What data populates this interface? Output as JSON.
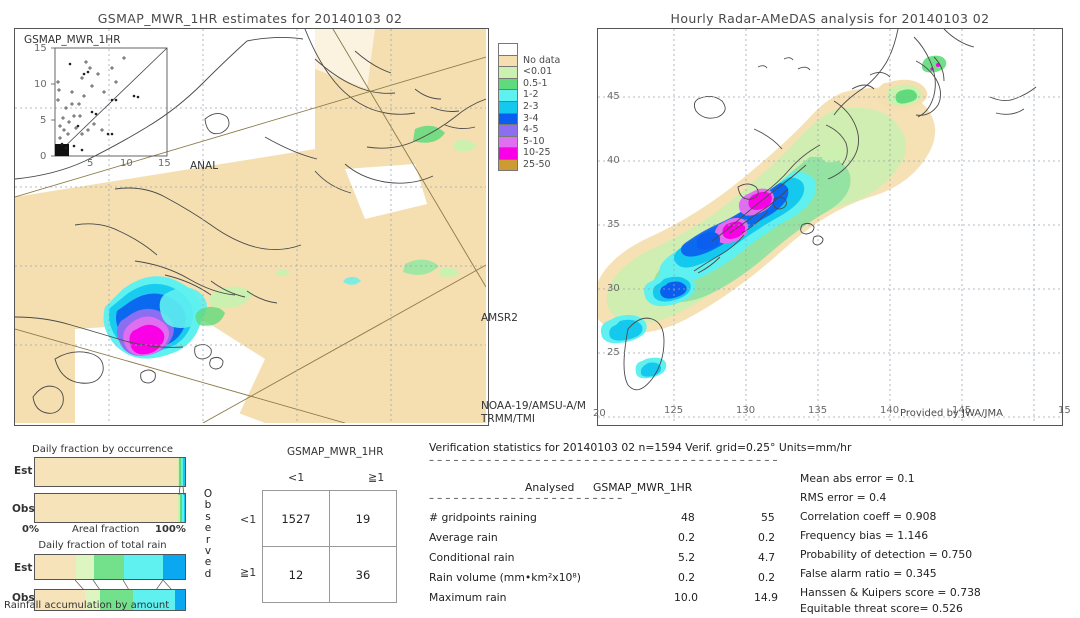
{
  "left_panel": {
    "title": "GSMAP_MWR_1HR estimates for 20140103 02",
    "inset": {
      "label": "GSMAP_MWR_1HR",
      "x_axis_label": "ANAL",
      "y_ticks": [
        "15",
        "10",
        "5",
        "0"
      ],
      "x_ticks": [
        "0",
        "5",
        "10",
        "15"
      ]
    },
    "annotations": [
      "AMSR2",
      "NOAA-19/AMSU-A/M",
      "TRMM/TMI"
    ]
  },
  "right_panel": {
    "title": "Hourly Radar-AMeDAS analysis for 20140103 02",
    "credit": "Provided by JWA/JMA",
    "lat_ticks": [
      "45",
      "40",
      "35",
      "30",
      "25",
      "20"
    ],
    "lon_ticks": [
      "125",
      "130",
      "135",
      "140",
      "145",
      "15"
    ]
  },
  "colorbar": {
    "entries": [
      {
        "label": "",
        "color": "#ffffff"
      },
      {
        "label": "No data",
        "color": "#f5dfb0"
      },
      {
        "label": "<0.01",
        "color": "#ccf0b0"
      },
      {
        "label": "0.5-1",
        "color": "#5fdb7b"
      },
      {
        "label": "1-2",
        "color": "#5ff0f0"
      },
      {
        "label": "2-3",
        "color": "#14c8ee"
      },
      {
        "label": "3-4",
        "color": "#0a5ef0"
      },
      {
        "label": "4-5",
        "color": "#8c6ef0"
      },
      {
        "label": "5-10",
        "color": "#e06ef0"
      },
      {
        "label": "10-25",
        "color": "#fa00e6"
      },
      {
        "label": "25-50",
        "color": "#cd9b32"
      }
    ]
  },
  "occurrence_chart": {
    "title": "Daily fraction by occurrence",
    "x_label": "Areal fraction",
    "x_min": "0%",
    "x_max": "100%",
    "rows": [
      {
        "label": "Est",
        "segments": [
          {
            "color": "#f7e3ba",
            "pct": 95.0
          },
          {
            "color": "#ccf0b0",
            "pct": 1.2
          },
          {
            "color": "#5fdb7b",
            "pct": 1.0
          },
          {
            "color": "#5ff0f0",
            "pct": 1.6
          },
          {
            "color": "#14c8ee",
            "pct": 1.2
          }
        ]
      },
      {
        "label": "Obs",
        "segments": [
          {
            "color": "#f7e3ba",
            "pct": 95.6
          },
          {
            "color": "#ccf0b0",
            "pct": 1.0
          },
          {
            "color": "#5fdb7b",
            "pct": 1.2
          },
          {
            "color": "#5ff0f0",
            "pct": 1.4
          },
          {
            "color": "#14c8ee",
            "pct": 0.8
          }
        ]
      }
    ]
  },
  "amount_chart": {
    "title": "Daily fraction of total rain",
    "caption": "Rainfall accumulation by amount",
    "rows": [
      {
        "label": "Est",
        "segments": [
          {
            "color": "#f7e3ba",
            "pct": 27.0
          },
          {
            "color": "#ddf5c0",
            "pct": 12.0
          },
          {
            "color": "#73e08c",
            "pct": 20.0
          },
          {
            "color": "#5ff0f0",
            "pct": 26.0
          },
          {
            "color": "#0aa8f0",
            "pct": 15.0
          }
        ]
      },
      {
        "label": "Obs",
        "segments": [
          {
            "color": "#f7e3ba",
            "pct": 33.0
          },
          {
            "color": "#ddf5c0",
            "pct": 10.0
          },
          {
            "color": "#73e08c",
            "pct": 22.0
          },
          {
            "color": "#5ff0f0",
            "pct": 28.0
          },
          {
            "color": "#0aa8f0",
            "pct": 7.0
          }
        ]
      }
    ]
  },
  "contingency": {
    "title": "GSMAP_MWR_1HR",
    "col_headers": [
      "<1",
      "≧1"
    ],
    "row_headers": [
      "<1",
      "≧1"
    ],
    "row_axis_label": "Observed",
    "cells": [
      [
        "1527",
        "19"
      ],
      [
        "12",
        "36"
      ]
    ]
  },
  "verification": {
    "header": "Verification statistics for 20140103 02   n=1594   Verif. grid=0.25°   Units=mm/hr",
    "divider": "– – – – – – – – – – – – – – – – – – – – – – – – – – – – – – – – – – – – – – – – – – –",
    "col_headers": [
      "Analysed",
      "GSMAP_MWR_1HR"
    ],
    "sub_divider": "– – – – – – – – – – – – – – – – – – – – – – – –",
    "rows": [
      {
        "name": "# gridpoints raining",
        "analysed": "48",
        "product": "55"
      },
      {
        "name": "Average rain",
        "analysed": "0.2",
        "product": "0.2"
      },
      {
        "name": "Conditional rain",
        "analysed": "5.2",
        "product": "4.7"
      },
      {
        "name": "Rain volume (mm•km²x10⁸)",
        "analysed": "0.2",
        "product": "0.2"
      },
      {
        "name": "Maximum rain",
        "analysed": "10.0",
        "product": "14.9"
      }
    ],
    "scores": [
      "Mean abs error = 0.1",
      "RMS error = 0.4",
      "Correlation coeff = 0.908",
      "Frequency bias = 1.146",
      "Probability of detection = 0.750",
      "False alarm ratio = 0.345",
      "Hanssen & Kuipers score = 0.738",
      "Equitable threat score= 0.526"
    ]
  }
}
